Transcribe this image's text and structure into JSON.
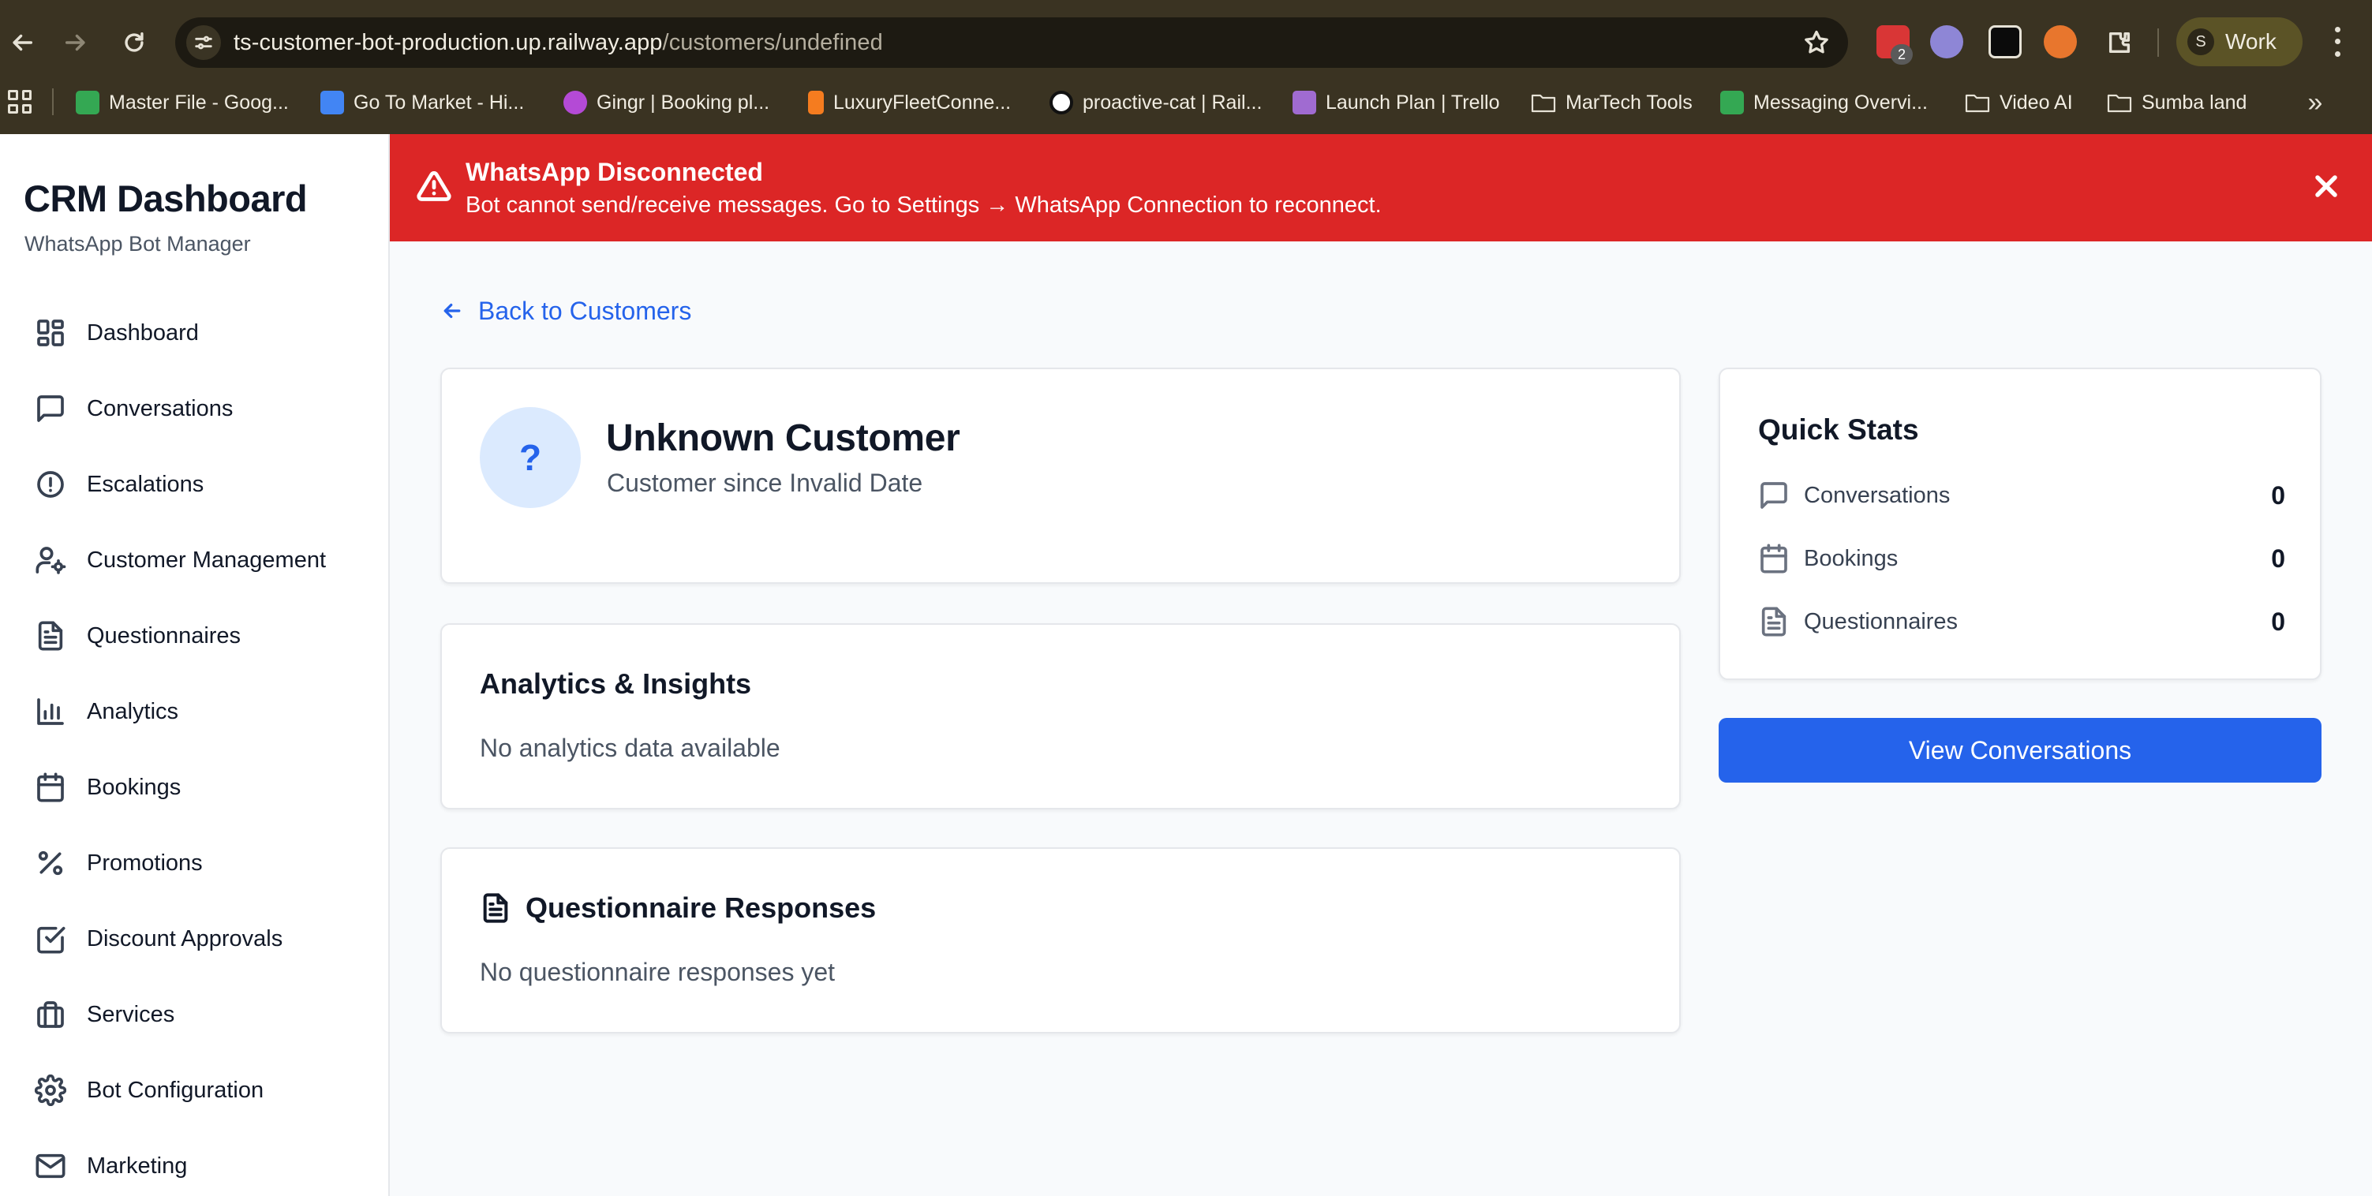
{
  "browser": {
    "url_host": "ts-customer-bot-production.up.railway.app",
    "url_path": "/customers/undefined",
    "extension_badge": "2",
    "profile_initial": "S",
    "profile_name": "Work",
    "bookmarks": [
      {
        "label": "Master File - Goog...",
        "icon": "sheets-icon",
        "color": "#34a853"
      },
      {
        "label": "Go To Market - Hi...",
        "icon": "docs-icon",
        "color": "#4285f4"
      },
      {
        "label": "Gingr | Booking pl...",
        "icon": "gingr-icon",
        "color": "#b44ad6"
      },
      {
        "label": "LuxuryFleetConne...",
        "icon": "luxuryfleet-icon",
        "color": "#f57c1f"
      },
      {
        "label": "proactive-cat | Rail...",
        "icon": "railway-icon",
        "color": "#ffffff"
      },
      {
        "label": "Launch Plan | Trello",
        "icon": "trello-icon",
        "color": "#a06bd1"
      },
      {
        "label": "MarTech Tools",
        "icon": "folder-icon"
      },
      {
        "label": "Messaging Overvi...",
        "icon": "sheets-icon",
        "color": "#34a853"
      },
      {
        "label": "Video AI",
        "icon": "folder-icon"
      },
      {
        "label": "Sumba land",
        "icon": "folder-icon"
      }
    ]
  },
  "sidebar": {
    "title": "CRM Dashboard",
    "subtitle": "WhatsApp Bot Manager",
    "items": [
      {
        "label": "Dashboard",
        "icon": "dashboard-icon"
      },
      {
        "label": "Conversations",
        "icon": "message-square-icon"
      },
      {
        "label": "Escalations",
        "icon": "alert-circle-icon"
      },
      {
        "label": "Customer Management",
        "icon": "user-cog-icon"
      },
      {
        "label": "Questionnaires",
        "icon": "file-text-icon"
      },
      {
        "label": "Analytics",
        "icon": "bar-chart-icon"
      },
      {
        "label": "Bookings",
        "icon": "calendar-icon"
      },
      {
        "label": "Promotions",
        "icon": "percent-icon"
      },
      {
        "label": "Discount Approvals",
        "icon": "check-square-icon"
      },
      {
        "label": "Services",
        "icon": "briefcase-icon"
      },
      {
        "label": "Bot Configuration",
        "icon": "settings-icon"
      },
      {
        "label": "Marketing",
        "icon": "mail-icon"
      }
    ]
  },
  "alert": {
    "title": "WhatsApp Disconnected",
    "message": "Bot cannot send/receive messages. Go to Settings → WhatsApp Connection to reconnect.",
    "color": "#dc2626"
  },
  "main": {
    "back_label": "Back to Customers",
    "customer": {
      "avatar_glyph": "?",
      "name": "Unknown Customer",
      "since": "Customer since Invalid Date"
    },
    "analytics": {
      "title": "Analytics & Insights",
      "empty": "No analytics data available"
    },
    "questionnaires": {
      "title": "Questionnaire Responses",
      "empty": "No questionnaire responses yet"
    },
    "quick_stats": {
      "title": "Quick Stats",
      "rows": [
        {
          "label": "Conversations",
          "value": "0",
          "icon": "message-square-icon"
        },
        {
          "label": "Bookings",
          "value": "0",
          "icon": "calendar-icon"
        },
        {
          "label": "Questionnaires",
          "value": "0",
          "icon": "file-text-icon"
        }
      ]
    },
    "view_button": "View Conversations",
    "accent": "#2563eb"
  }
}
